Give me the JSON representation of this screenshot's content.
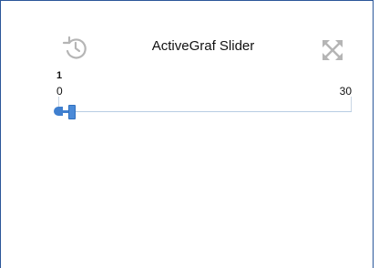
{
  "widget": {
    "title": "ActiveGraf Slider",
    "icons": {
      "history": "history-icon",
      "fullscreen": "fullscreen-icon"
    },
    "colors": {
      "frame": "#2b579a",
      "accent": "#3f7fcf",
      "track": "#b8cde3"
    }
  },
  "slider": {
    "value_label": "1",
    "min_label": "0",
    "max_label": "30",
    "value": 1,
    "min": 0,
    "max": 30
  }
}
